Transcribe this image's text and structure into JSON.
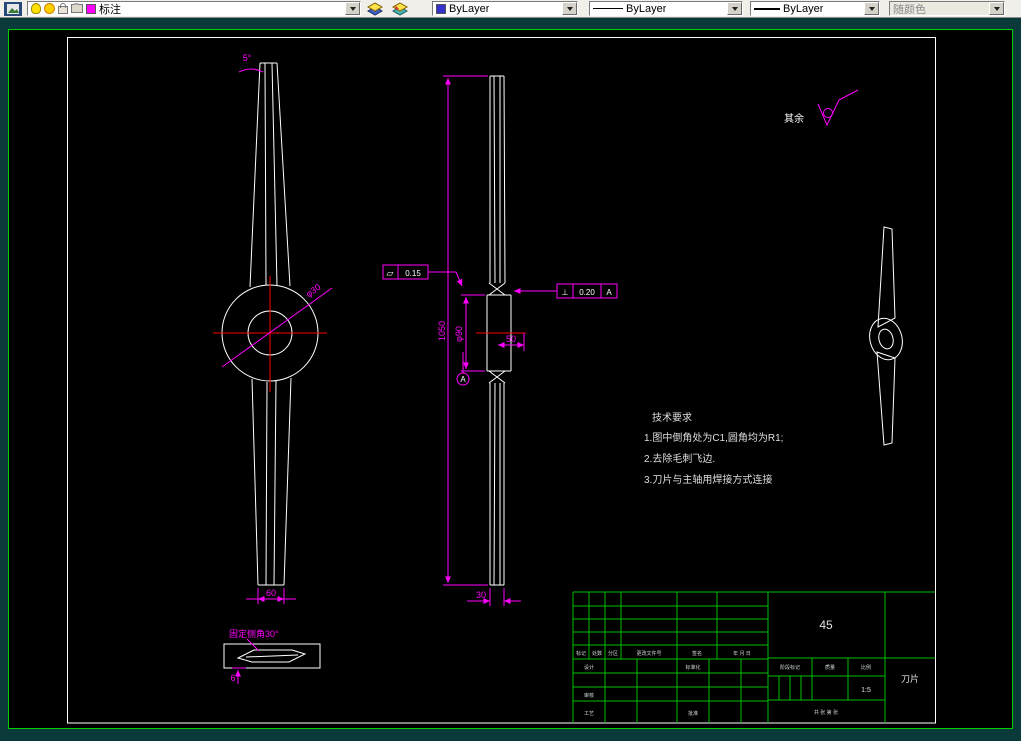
{
  "toolbar": {
    "layer_combo": {
      "layer_name": "标注"
    },
    "color_combo": {
      "value": "ByLayer"
    },
    "linetype_combo": {
      "value": "ByLayer"
    },
    "lineweight_combo": {
      "value": "ByLayer"
    },
    "plot_style_combo": {
      "value": "随颜色"
    }
  },
  "colors": {
    "dimension": "#ff00ff",
    "geometry": "#ffffff",
    "centerline": "#ff0000",
    "table_lines": "#00c000",
    "layer_swatch": "#ff00ff",
    "color_swatch": "#3333cc"
  },
  "annotations": {
    "surface_note": "其余",
    "front_view": {
      "angle": "5°",
      "bore": "φ30",
      "width": "60"
    },
    "side_view": {
      "length": "1050",
      "hub_dia": "φ90",
      "hub_width": "50",
      "tip_width": "30",
      "flatness": {
        "symbol": "▱",
        "value": "0.15"
      },
      "perpendicularity": {
        "symbol": "⊥",
        "value": "0.20",
        "datum": "A"
      },
      "datum_label": "A"
    },
    "detail_view": {
      "note": "固定侧角30°",
      "dim": "6"
    },
    "tech_requirements": {
      "title": "技术要求",
      "items": [
        "1.图中倒角处为C1,圆角均为R1;",
        "2.去除毛刺飞边.",
        "3.刀片与主轴用焊接方式连接"
      ]
    }
  },
  "title_block": {
    "material": "45",
    "part_name": "刀片",
    "scale": "1:5",
    "headers": {
      "mark": "标记",
      "count": "处数",
      "zone": "分区",
      "doc_no": "更改文件号",
      "sign": "签名",
      "date": "年 月 日"
    },
    "roles": {
      "design": "设计",
      "standard": "标准化",
      "check": "审核",
      "process": "工艺",
      "approve": "批准"
    },
    "stage": {
      "label": "阶段标记",
      "weight": "质量",
      "scale_label": "比例"
    },
    "sheet": "共 张 第 张"
  }
}
